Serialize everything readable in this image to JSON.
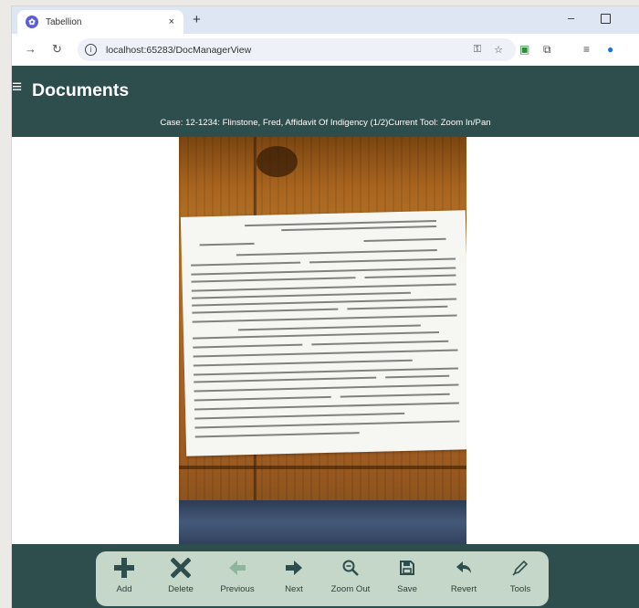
{
  "browser": {
    "tab_title": "Tabellion",
    "tab_close": "×",
    "new_tab": "+",
    "minimize": "–",
    "url": "localhost:65283/DocManagerView"
  },
  "app": {
    "title": "Documents",
    "case_line": "Case: 12-1234: Flinstone, Fred, Affidavit Of Indigency (1/2)Current Tool: Zoom In/Pan"
  },
  "actions": [
    {
      "label": "Add",
      "icon": "plus-icon"
    },
    {
      "label": "Delete",
      "icon": "x-icon"
    },
    {
      "label": "Previous",
      "icon": "arrow-left-icon"
    },
    {
      "label": "Next",
      "icon": "arrow-right-icon"
    },
    {
      "label": "Zoom Out",
      "icon": "zoom-out-icon"
    },
    {
      "label": "Save",
      "icon": "save-icon"
    },
    {
      "label": "Revert",
      "icon": "revert-icon"
    },
    {
      "label": "Tools",
      "icon": "pen-icon"
    }
  ],
  "colors": {
    "header_bg": "#2e4d4d",
    "toolbar_pill": "#c4d7c9",
    "icon_active": "#2e4d4d",
    "icon_disabled": "#8fb59c"
  }
}
